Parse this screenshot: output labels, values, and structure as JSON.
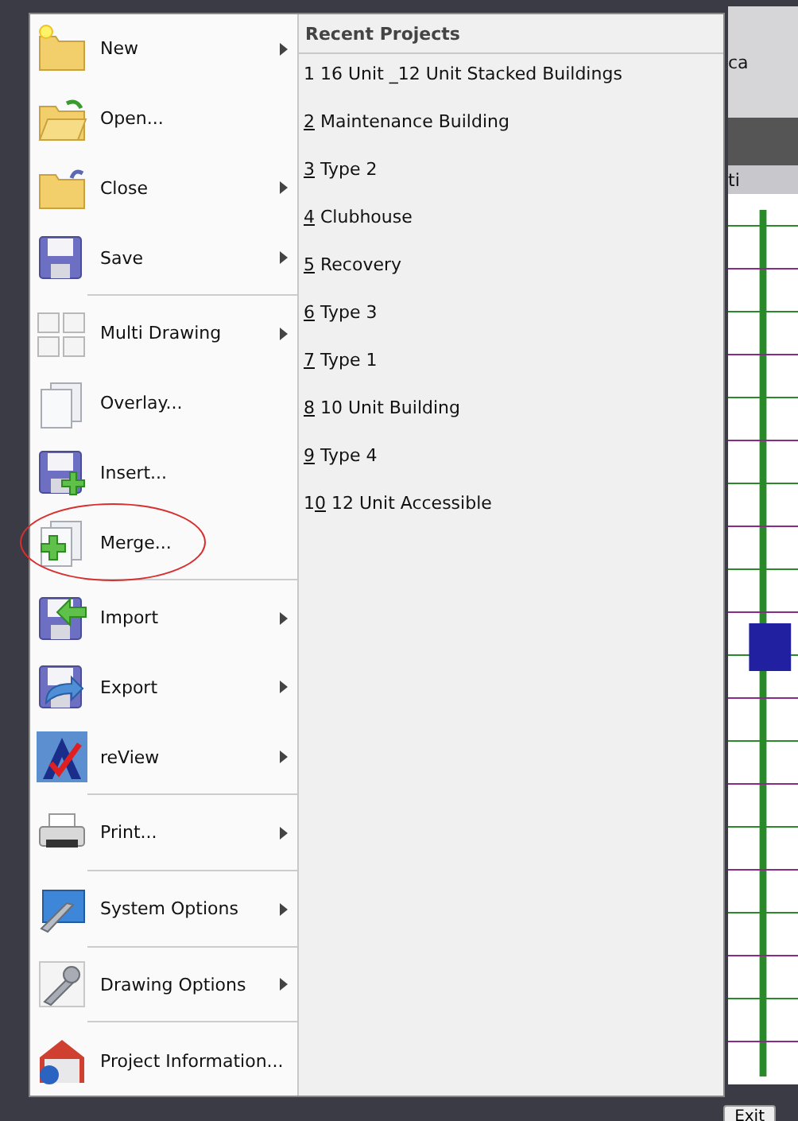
{
  "menu": {
    "items": [
      {
        "kind": "folder-new",
        "label": "New",
        "submenu": true,
        "separator_before": false,
        "circled": false
      },
      {
        "kind": "folder-open",
        "label": "Open...",
        "submenu": false,
        "separator_before": false,
        "circled": false
      },
      {
        "kind": "folder-close",
        "label": "Close",
        "submenu": true,
        "separator_before": false,
        "circled": false
      },
      {
        "kind": "disk",
        "label": "Save",
        "submenu": true,
        "separator_before": false,
        "circled": false
      },
      {
        "kind": "grid",
        "label": "Multi Drawing",
        "submenu": true,
        "separator_before": true,
        "circled": false
      },
      {
        "kind": "pages",
        "label": "Overlay...",
        "submenu": false,
        "separator_before": false,
        "circled": false
      },
      {
        "kind": "disk-plus",
        "label": "Insert...",
        "submenu": false,
        "separator_before": false,
        "circled": false
      },
      {
        "kind": "pages-plus",
        "label": "Merge...",
        "submenu": false,
        "separator_before": false,
        "circled": true
      },
      {
        "kind": "disk-arrow",
        "label": "Import",
        "submenu": true,
        "separator_before": true,
        "circled": false
      },
      {
        "kind": "disk-export",
        "label": "Export",
        "submenu": true,
        "separator_before": false,
        "circled": false
      },
      {
        "kind": "review",
        "label": "reView",
        "submenu": true,
        "separator_before": false,
        "circled": false
      },
      {
        "kind": "printer",
        "label": "Print...",
        "submenu": true,
        "separator_before": true,
        "circled": false
      },
      {
        "kind": "monitor-wrench",
        "label": "System Options",
        "submenu": true,
        "separator_before": true,
        "circled": false
      },
      {
        "kind": "wrench",
        "label": "Drawing Options",
        "submenu": true,
        "separator_before": true,
        "circled": false
      },
      {
        "kind": "house-info",
        "label": "Project Information...",
        "submenu": false,
        "separator_before": true,
        "circled": false
      }
    ]
  },
  "recent": {
    "title": "Recent Projects",
    "items": [
      {
        "number": "1",
        "name": "16 Unit _12 Unit Stacked Buildings"
      },
      {
        "key": "2",
        "name": "Maintenance Building"
      },
      {
        "key": "3",
        "name": "Type 2"
      },
      {
        "key": "4",
        "name": "Clubhouse"
      },
      {
        "key": "5",
        "name": "Recovery"
      },
      {
        "key": "6",
        "name": "Type 3"
      },
      {
        "key": "7",
        "name": "Type 1"
      },
      {
        "key": "8",
        "name": "10 Unit Building"
      },
      {
        "key": "9",
        "name": "Type 4"
      },
      {
        "number": "1",
        "key": "0",
        "name": "12 Unit Accessible"
      }
    ]
  },
  "background": {
    "fragments": [
      "ca",
      "ti"
    ],
    "button": "Exit"
  }
}
